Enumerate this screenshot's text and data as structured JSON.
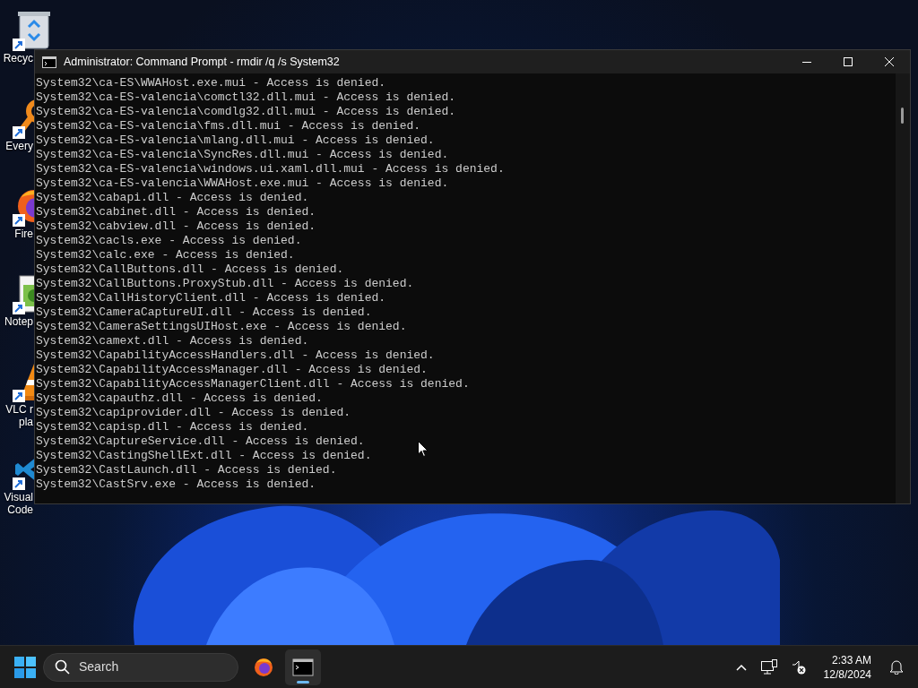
{
  "desktop_icons": [
    {
      "kind": "recycle",
      "labels": [
        "Recyc"
      ]
    },
    {
      "kind": "search",
      "labels": [
        "Every"
      ]
    },
    {
      "kind": "browser",
      "labels": [
        "Fire"
      ]
    },
    {
      "kind": "notepad",
      "labels": [
        "Notep"
      ]
    },
    {
      "kind": "cone",
      "labels": [
        "VLC r",
        "pla"
      ]
    },
    {
      "kind": "code",
      "labels": [
        "Visual",
        "Code"
      ]
    }
  ],
  "window": {
    "title": "Administrator: Command Prompt - rmdir  /q /s System32",
    "lines": [
      "System32\\ca-ES\\WWAHost.exe.mui - Access is denied.",
      "System32\\ca-ES-valencia\\comctl32.dll.mui - Access is denied.",
      "System32\\ca-ES-valencia\\comdlg32.dll.mui - Access is denied.",
      "System32\\ca-ES-valencia\\fms.dll.mui - Access is denied.",
      "System32\\ca-ES-valencia\\mlang.dll.mui - Access is denied.",
      "System32\\ca-ES-valencia\\SyncRes.dll.mui - Access is denied.",
      "System32\\ca-ES-valencia\\windows.ui.xaml.dll.mui - Access is denied.",
      "System32\\ca-ES-valencia\\WWAHost.exe.mui - Access is denied.",
      "System32\\cabapi.dll - Access is denied.",
      "System32\\cabinet.dll - Access is denied.",
      "System32\\cabview.dll - Access is denied.",
      "System32\\cacls.exe - Access is denied.",
      "System32\\calc.exe - Access is denied.",
      "System32\\CallButtons.dll - Access is denied.",
      "System32\\CallButtons.ProxyStub.dll - Access is denied.",
      "System32\\CallHistoryClient.dll - Access is denied.",
      "System32\\CameraCaptureUI.dll - Access is denied.",
      "System32\\CameraSettingsUIHost.exe - Access is denied.",
      "System32\\camext.dll - Access is denied.",
      "System32\\CapabilityAccessHandlers.dll - Access is denied.",
      "System32\\CapabilityAccessManager.dll - Access is denied.",
      "System32\\CapabilityAccessManagerClient.dll - Access is denied.",
      "System32\\capauthz.dll - Access is denied.",
      "System32\\capiprovider.dll - Access is denied.",
      "System32\\capisp.dll - Access is denied.",
      "System32\\CaptureService.dll - Access is denied.",
      "System32\\CastingShellExt.dll - Access is denied.",
      "System32\\CastLaunch.dll - Access is denied.",
      "System32\\CastSrv.exe - Access is denied."
    ]
  },
  "taskbar": {
    "search": {
      "label": "Search"
    },
    "apps": [
      {
        "kind": "browser",
        "active": false
      },
      {
        "kind": "terminal",
        "active": true
      }
    ],
    "clock": {
      "time": "2:33 AM",
      "date": "12/8/2024"
    }
  }
}
